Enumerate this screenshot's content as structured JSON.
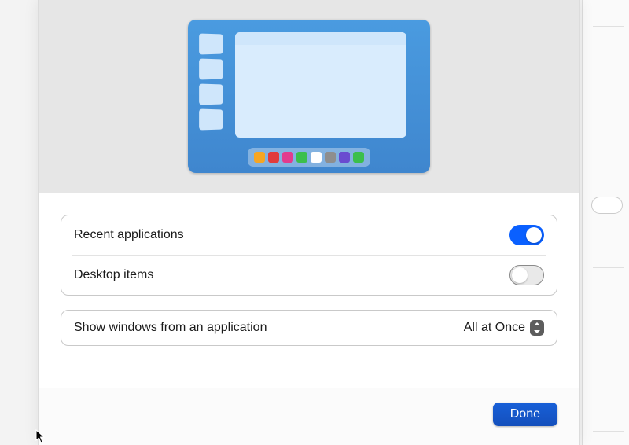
{
  "preview": {
    "dock_colors": [
      "#f6a623",
      "#e23b3b",
      "#e23b8e",
      "#3bbf4b",
      "#ffffff",
      "#8e8e8e",
      "#6a4bd0",
      "#3bbf4b"
    ]
  },
  "settings": {
    "group1": [
      {
        "label": "Recent applications",
        "value": true
      },
      {
        "label": "Desktop items",
        "value": false
      }
    ],
    "group2": {
      "label": "Show windows from an application",
      "selected": "All at Once"
    }
  },
  "footer": {
    "done_label": "Done"
  }
}
